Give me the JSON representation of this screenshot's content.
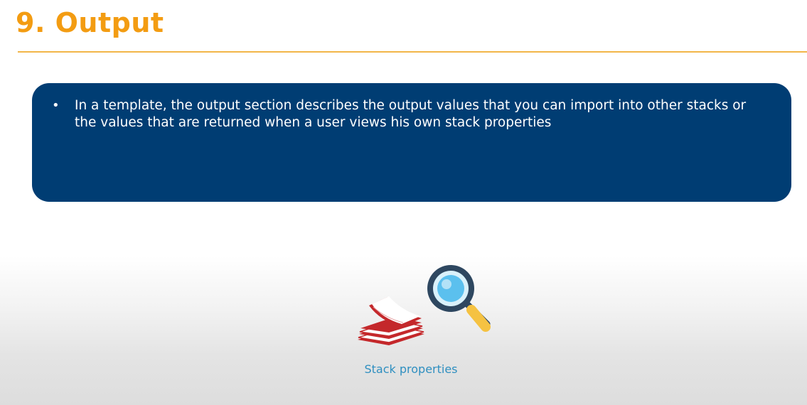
{
  "slide": {
    "title": "9. Output"
  },
  "content": {
    "bullets": [
      {
        "marker": "•",
        "text": "In a template, the output section describes the output values that you can import into other stacks or the values that are returned when a user views his own stack properties"
      }
    ]
  },
  "illustration": {
    "icons": [
      "paper-stack-icon",
      "magnifying-glass-icon"
    ],
    "caption": "Stack properties"
  },
  "colors": {
    "title": "#f39c12",
    "rule": "#f2b648",
    "box": "#003d73",
    "caption": "#2f8fc0",
    "paper": "#c4282b",
    "magnifier_rim": "#2e4760",
    "magnifier_lens": "#5bc0ee",
    "magnifier_handle": "#f5c242"
  }
}
